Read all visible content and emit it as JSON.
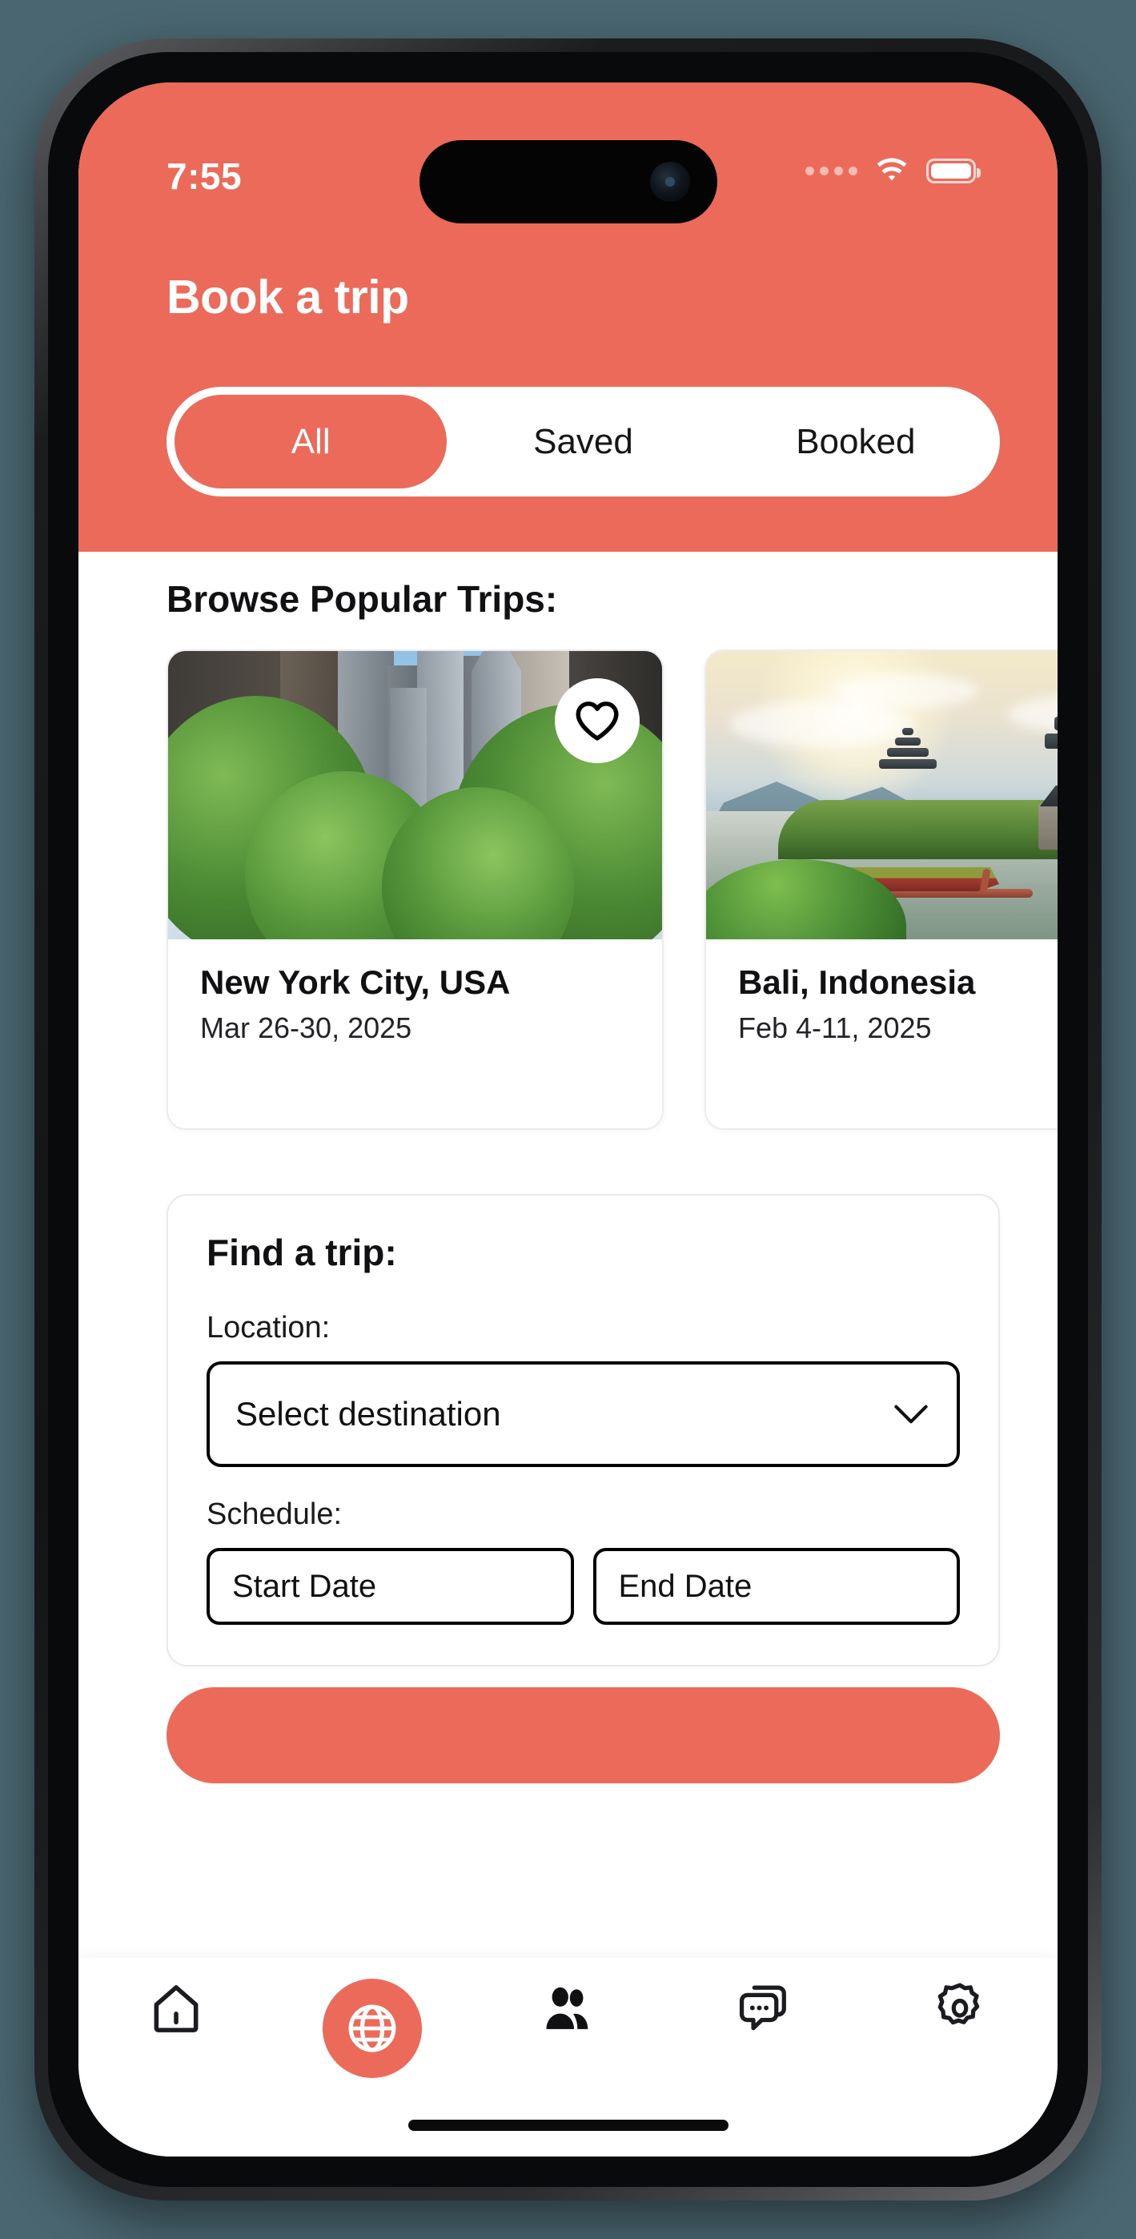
{
  "status_bar": {
    "time": "7:55",
    "signal_icon": "signal-dots-icon",
    "wifi_icon": "wifi-icon",
    "battery_icon": "battery-icon"
  },
  "header": {
    "title": "Book a trip",
    "accent_color": "#EC6A59"
  },
  "tabs": {
    "items": [
      {
        "label": "All",
        "active": true
      },
      {
        "label": "Saved",
        "active": false
      },
      {
        "label": "Booked",
        "active": false
      }
    ]
  },
  "browse": {
    "section_title": "Browse Popular Trips:",
    "cards": [
      {
        "title": "New York City, USA",
        "dates": "Mar 26-30, 2025",
        "photo_alt": "new-york-street-photo",
        "favorite_icon": "heart-icon",
        "favorited": false
      },
      {
        "title": "Bali, Indonesia",
        "dates": "Feb 4-11, 2025",
        "photo_alt": "bali-temple-lake-photo"
      }
    ]
  },
  "find_form": {
    "title": "Find a trip:",
    "location_label": "Location:",
    "destination_value": "Select destination",
    "destination_chevron": "chevron-down-icon",
    "schedule_label": "Schedule:",
    "start_date_placeholder": "Start Date",
    "end_date_placeholder": "End Date",
    "submit_label": ""
  },
  "bottom_nav": {
    "items": [
      {
        "icon": "home-icon",
        "active": false
      },
      {
        "icon": "globe-icon",
        "active": true
      },
      {
        "icon": "people-icon",
        "active": false
      },
      {
        "icon": "chat-icon",
        "active": false
      },
      {
        "icon": "settings-gear-icon",
        "active": false
      }
    ]
  }
}
